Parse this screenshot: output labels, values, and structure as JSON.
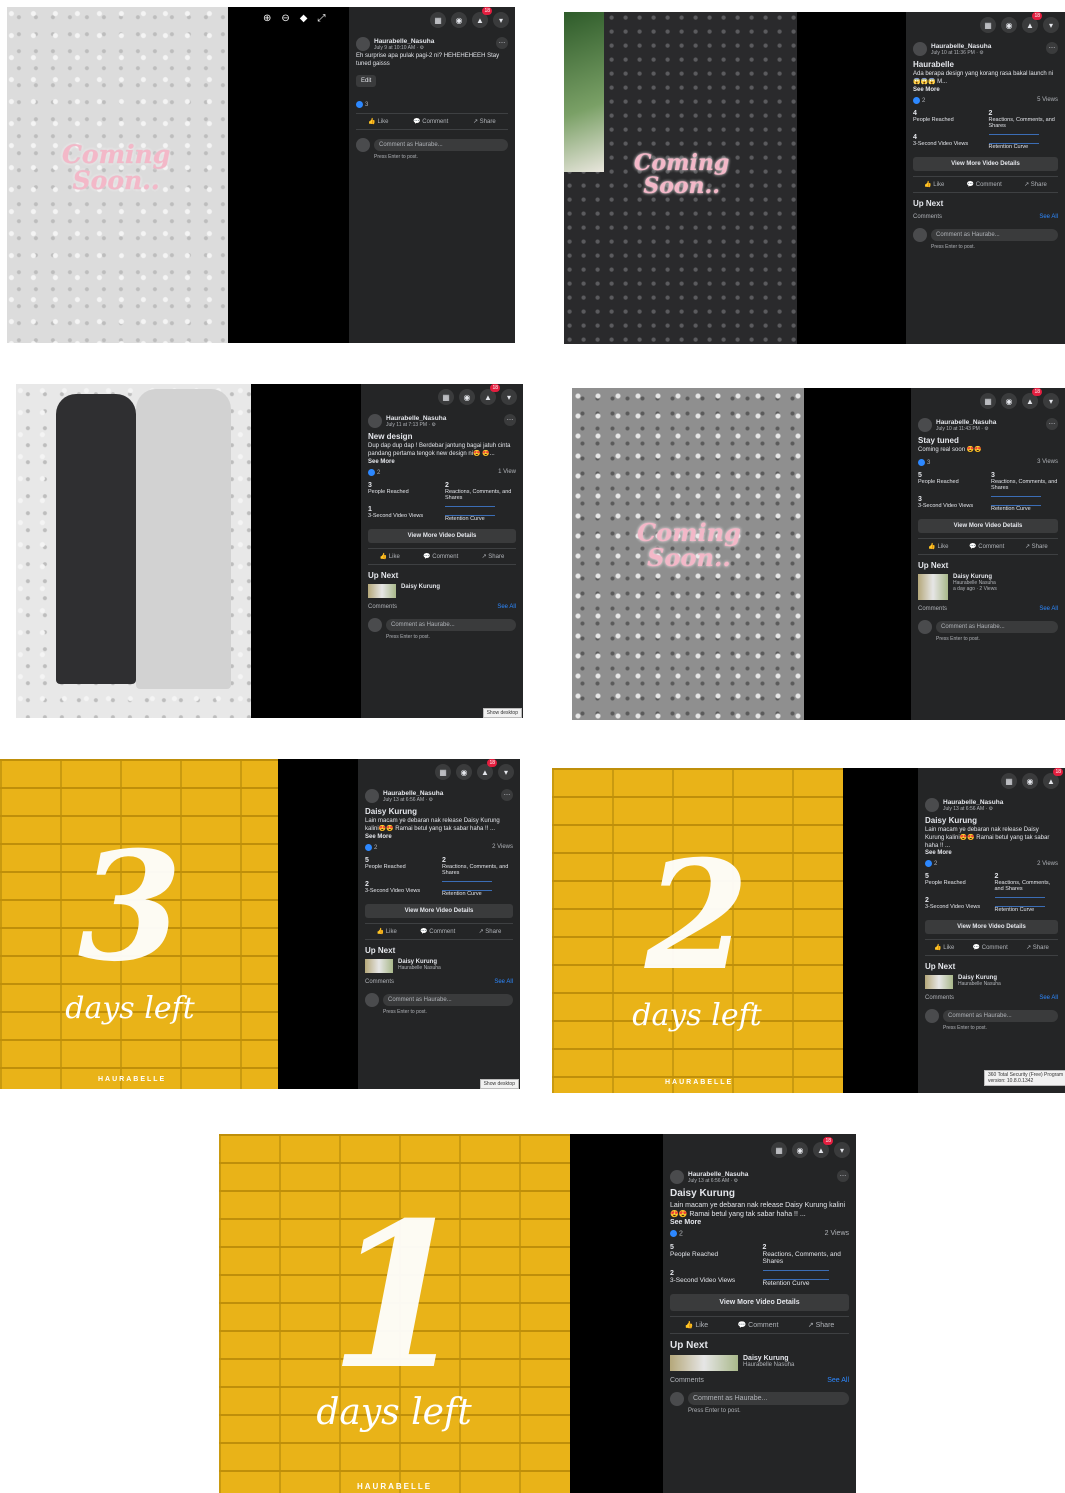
{
  "shared": {
    "author": "Haurabelle_Nasuha",
    "edit": "Edit",
    "like": "Like",
    "comment": "Comment",
    "share": "Share",
    "see_more": "See More",
    "people_reached": "People Reached",
    "reactions": "Reactions, Comments, and Shares",
    "three_sec": "3-Second Video Views",
    "retention": "Retention Curve",
    "view_details": "View More Video Details",
    "up_next": "Up Next",
    "comments": "Comments",
    "see_all": "See All",
    "comment_placeholder": "Comment as Haurabe...",
    "press_enter": "Press Enter to post.",
    "notifications": "18",
    "coming_line1": "Coming",
    "coming_line2": "Soon..",
    "days_left": "days left",
    "brand": "HAURABELLE",
    "show_desktop": "Show desktop",
    "up_next_title": "Daisy Kurung",
    "up_next_channel": "Haurabelle Nasuha",
    "up_next_meta": "a day ago · 2 Views"
  },
  "posts": [
    {
      "date": "July 9 at 10:10 AM · ⚙",
      "title": "",
      "text": "Eh surprise apa pulak pagi-2 ni? HEHEHEHEEH Stay tuned gaisss",
      "reactions": "3",
      "views": ""
    },
    {
      "date": "July 10 at 11:36 PM · ⚙",
      "title": "Haurabelle",
      "text": "Ada berapa design yang korang rasa bakal launch ni 😱😱😱 M...",
      "reactions": "2",
      "views": "5 Views",
      "reached": "4",
      "rcs": "2",
      "v3": "4"
    },
    {
      "date": "July 11 at 7:13 PM · ⚙",
      "title": "New design",
      "text": "Dup dap dup dap ! Berdebar jantung bagai jatuh cinta pandang pertama tengok new design ni😍 😍...",
      "reactions": "2",
      "views": "1 View",
      "reached": "3",
      "rcs": "2",
      "v3": "1"
    },
    {
      "date": "July 10 at 11:43 PM · ⚙",
      "title": "Stay tuned",
      "text": "Coming real soon 😍😍",
      "reactions": "3",
      "views": "3 Views",
      "reached": "5",
      "rcs": "3",
      "v3": "3"
    },
    {
      "date": "July 13 at 6:56 AM · ⚙",
      "title": "Daisy Kurung",
      "text": "Lain macam ye debaran nak release Daisy Kurung kalini😍😍 Ramai betul yang tak sabar haha !! ...",
      "reactions": "2",
      "views": "2 Views",
      "reached": "5",
      "rcs": "2",
      "v3": "2",
      "number": "3"
    },
    {
      "date": "July 13 at 6:56 AM · ⚙",
      "title": "Daisy Kurung",
      "text": "Lain macam ye debaran nak release Daisy Kurung kalini😍😍 Ramai betul yang tak sabar haha !! ...",
      "reactions": "2",
      "views": "2 Views",
      "reached": "5",
      "rcs": "2",
      "v3": "2",
      "number": "2"
    },
    {
      "date": "July 13 at 6:56 AM · ⚙",
      "title": "Daisy Kurung",
      "text": "Lain macam ye debaran nak release Daisy Kurung kalini😍😍 Ramai betul yang tak sabar haha !! ...",
      "reactions": "2",
      "views": "2 Views",
      "reached": "5",
      "rcs": "2",
      "v3": "2",
      "number": "1"
    }
  ],
  "security_popup": "360 Total Security (Free) Program version: 10.8.0.1342"
}
